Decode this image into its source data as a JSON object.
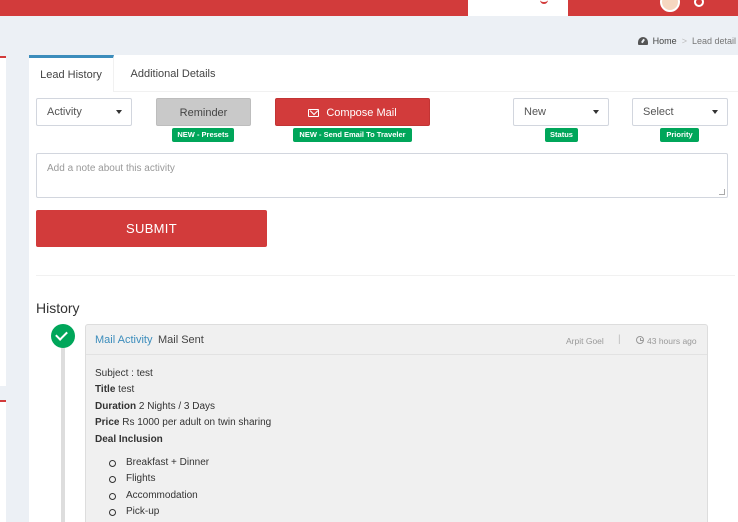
{
  "breadcrumb": {
    "home": "Home",
    "sep": ">",
    "current": "Lead detail"
  },
  "tabs": [
    {
      "label": "Lead History"
    },
    {
      "label": "Additional Details"
    }
  ],
  "controls": {
    "activity": {
      "selected": "Activity"
    },
    "reminder": {
      "label": "Reminder",
      "badge": "NEW - Presets"
    },
    "compose": {
      "label": "Compose Mail",
      "badge": "NEW - Send Email To Traveler"
    },
    "status": {
      "selected": "New",
      "badge": "Status"
    },
    "priority": {
      "selected": "Select",
      "badge": "Priority"
    }
  },
  "note": {
    "placeholder": "Add a note about this activity"
  },
  "submit_label": "SUBMIT",
  "history": {
    "title": "History",
    "items": [
      {
        "type_link": "Mail Activity",
        "heading": "Mail Sent",
        "author": "Arpit Goel",
        "separator": "|",
        "time": "43 hours ago",
        "subject": "Subject : test",
        "title_label": "Title",
        "title_value": "test",
        "duration_label": "Duration",
        "duration_value": "2 Nights / 3 Days",
        "price_label": "Price",
        "price_value": "Rs 1000 per adult on twin sharing",
        "inclusion_label": "Deal Inclusion",
        "inclusions": [
          "Breakfast + Dinner",
          "Flights",
          "Accommodation",
          "Pick-up"
        ]
      }
    ]
  },
  "colors": {
    "brand": "#d23b3b",
    "success": "#00a65a",
    "link": "#3c8dbc"
  }
}
